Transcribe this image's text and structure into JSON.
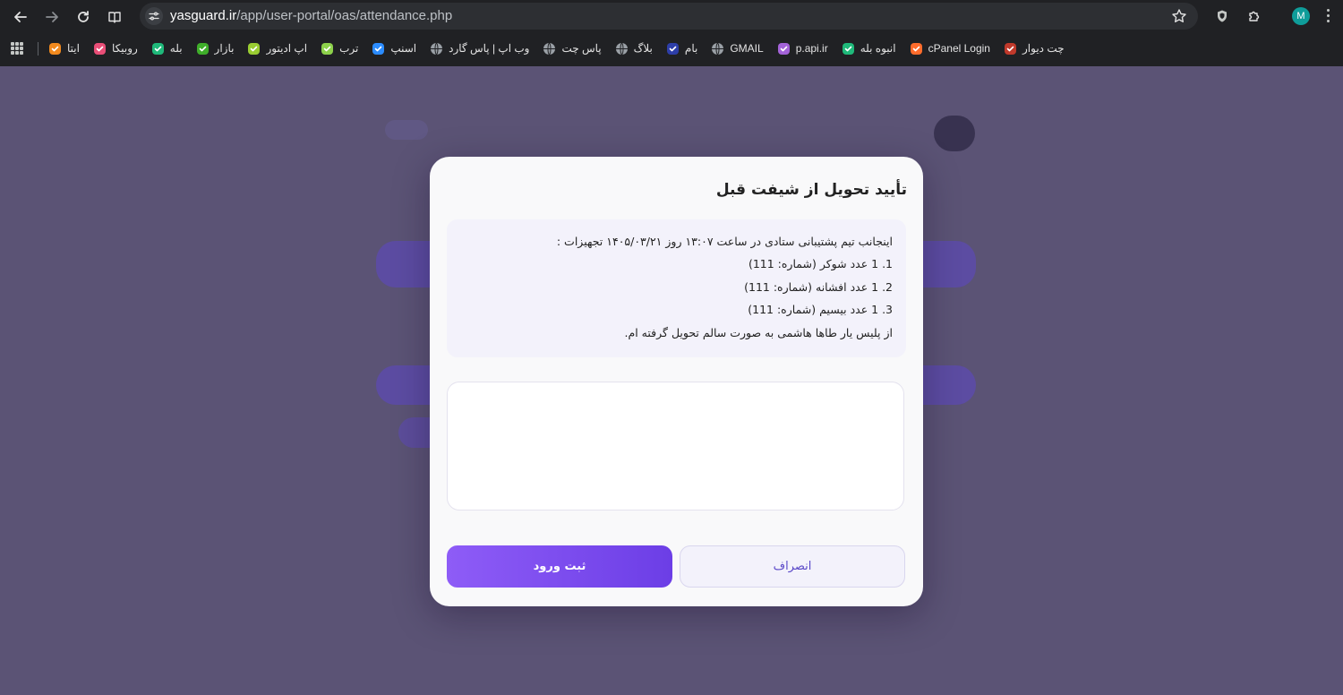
{
  "browser": {
    "url_host": "yasguard.ir",
    "url_path": "/app/user-portal/oas/attendance.php",
    "profile_initial": "M",
    "bookmarks": [
      {
        "label": "ایتا",
        "icon": "eitaa-icon",
        "color": "#f28a1e"
      },
      {
        "label": "روبیکا",
        "icon": "rubika-icon",
        "color": "#e94e77"
      },
      {
        "label": "بله",
        "icon": "bale-icon",
        "color": "#1fb97a"
      },
      {
        "label": "بازار",
        "icon": "bazaar-icon",
        "color": "#3fae2a"
      },
      {
        "label": "اپ ادیتور",
        "icon": "app-editor-icon",
        "color": "#9acd32"
      },
      {
        "label": "ترب",
        "icon": "torob-icon",
        "color": "#8dd14b"
      },
      {
        "label": "اسنپ",
        "icon": "snapp-icon",
        "color": "#2b8cff"
      },
      {
        "label": "وب اپ | پاس گارد",
        "icon": "globe-icon",
        "color": "#9aa0a6"
      },
      {
        "label": "پاس چت",
        "icon": "globe-icon",
        "color": "#9aa0a6"
      },
      {
        "label": "بلاگ",
        "icon": "globe-icon",
        "color": "#9aa0a6"
      },
      {
        "label": "بام",
        "icon": "bam-icon",
        "color": "#2d3ea8"
      },
      {
        "label": "GMAIL",
        "icon": "globe-icon",
        "color": "#9aa0a6"
      },
      {
        "label": "p.api.ir",
        "icon": "papi-icon",
        "color": "#a463d9"
      },
      {
        "label": "انبوه بله",
        "icon": "bale-icon",
        "color": "#1fb97a"
      },
      {
        "label": "cPanel Login",
        "icon": "cpanel-icon",
        "color": "#ff6c2c"
      },
      {
        "label": "چت دیوار",
        "icon": "divar-icon",
        "color": "#c0392b"
      }
    ]
  },
  "modal": {
    "title": "تأیید تحویل از شیفت قبل",
    "terms": [
      "اینجانب تیم پشتیبانی ستادی در ساعت ۱۳:۰۷ روز ۱۴۰۵/۰۳/۲۱ تجهیزات :",
      "1. 1 عدد شوکر (شماره: 111)",
      "2. 1 عدد افشانه (شماره: 111)",
      "3. 1 عدد بیسیم (شماره: 111)",
      "از پلیس یار طاها هاشمی به صورت سالم تحویل گرفته ام."
    ],
    "comment_value": "",
    "cancel_label": "انصراف",
    "submit_label": "ثبت ورود"
  },
  "colors": {
    "accent": "#7c4dff",
    "backdrop": "#5b5375"
  }
}
